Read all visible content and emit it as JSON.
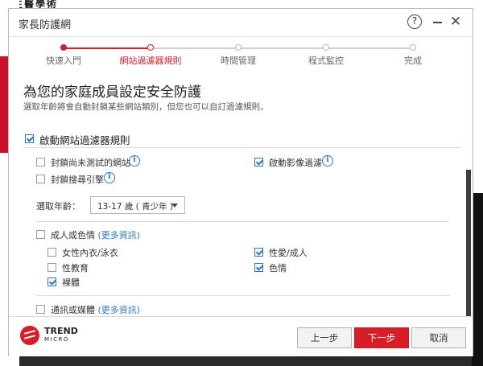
{
  "background": {
    "top_text": "客生醫學術"
  },
  "window": {
    "title": "家長防護網"
  },
  "stepper": {
    "steps": [
      {
        "label": "快速入門",
        "state": "done"
      },
      {
        "label": "網站過濾器規則",
        "state": "active"
      },
      {
        "label": "時間管理",
        "state": "pending"
      },
      {
        "label": "程式監控",
        "state": "pending"
      },
      {
        "label": "完成",
        "state": "pending"
      }
    ],
    "accent": "#d71e28"
  },
  "main": {
    "heading": "為您的家庭成員設定安全防護",
    "subheading": "選取年齡將會自動封鎖某些網站類別，但您也可以自訂過濾規則。",
    "enable_filter": {
      "label": "啟動網站過濾器規則",
      "checked": true
    },
    "options": {
      "block_untested": {
        "label": "封鎖尚未測試的網站",
        "checked": false,
        "icon": "info-icon"
      },
      "block_search": {
        "label": "封鎖搜尋引擎",
        "checked": false,
        "icon": "info-icon"
      },
      "video_filter": {
        "label": "啟動影像過濾",
        "checked": true,
        "icon": "info-icon"
      }
    },
    "age": {
      "label": "選取年齡：",
      "value": "13-17 歲 ( 青少年 )"
    },
    "categories": [
      {
        "label": "成人或色情",
        "link": "(更多資訊)",
        "checked": false,
        "items": [
          {
            "label": "女性內衣/泳衣",
            "checked": false
          },
          {
            "label": "性愛/成人",
            "checked": true
          },
          {
            "label": "性教育",
            "checked": false
          },
          {
            "label": "色情",
            "checked": true
          },
          {
            "label": "裸體",
            "checked": true
          }
        ]
      },
      {
        "label": "通訊或媒體",
        "link": "(更多資訊)",
        "checked": false
      }
    ]
  },
  "footer": {
    "brand_line1": "TREND",
    "brand_line2": "MICRO",
    "prev_label": "上一步",
    "next_label": "下一步",
    "cancel_label": "取消"
  },
  "colors": {
    "brand_red": "#d71e28",
    "check_blue": "#2f76c6"
  }
}
